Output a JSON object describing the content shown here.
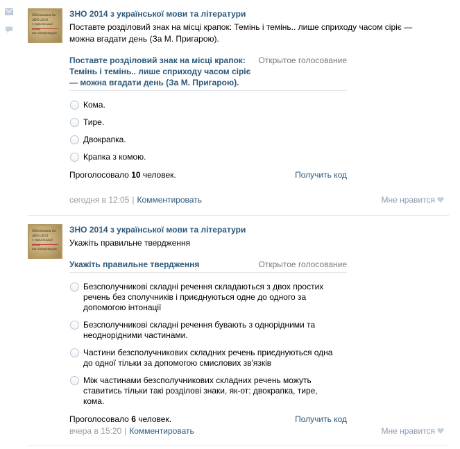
{
  "sidebar": {
    "icons": [
      "mail-icon",
      "comment-icon"
    ]
  },
  "posts": [
    {
      "author": "ЗНО 2014 з української мови та літератури",
      "thumb_lines": [
        "Підготовка до",
        "ЗНО 2014",
        "з української мови",
        "та літератури"
      ],
      "text": "Поставте розділовий знак на місці крапок: Темінь і темінь.. лише сприходу часом сіріє — можна вгадати день (За М. Пригарою).",
      "poll": {
        "question": "Поставте розділовий знак на місці крапок: Темінь і темінь.. лише сприходу часом сіріє — можна вгадати день (За М. Пригарою).",
        "type": "Открытое голосование",
        "options": [
          "Кома.",
          "Тире.",
          "Двокрапка.",
          "Крапка з комою."
        ],
        "votes_prefix": "Проголосовало ",
        "votes_count": "10",
        "votes_suffix": " человек.",
        "get_code": "Получить код"
      },
      "date": "сегодня в 12:05",
      "comment": "Комментировать",
      "like": "Мне нравится"
    },
    {
      "author": "ЗНО 2014 з української мови та літератури",
      "thumb_lines": [
        "Підготовка до",
        "ЗНО 2014",
        "з української мови",
        "та літератури"
      ],
      "text": "Укажіть правильне твердження",
      "poll": {
        "question": "Укажіть правильне твердження",
        "type": "Открытое голосование",
        "options": [
          "Безсполучникові складні речення складаються з двох простих речень без сполучників і приєднуються одне до одного за допомогою інтонації",
          "Безсполучникові складні речення бувають з однорідними та неоднорідними частинами.",
          "Частини безсполучникових складних речень приєднуються одна до одної тільки за допомогою смислових зв'язків",
          "Між частинами безсполучникових складних речень можуть ставитись тільки такі розділові знаки, як-от: двокрапка, тире, кома."
        ],
        "votes_prefix": "Проголосовало ",
        "votes_count": "6",
        "votes_suffix": " человек.",
        "get_code": "Получить код"
      },
      "date": "вчера в 15:20",
      "comment": "Комментировать",
      "like": "Мне нравится"
    }
  ],
  "colors": {
    "link": "#2b587a",
    "muted": "#999999",
    "divider": "#e7ebf0"
  }
}
